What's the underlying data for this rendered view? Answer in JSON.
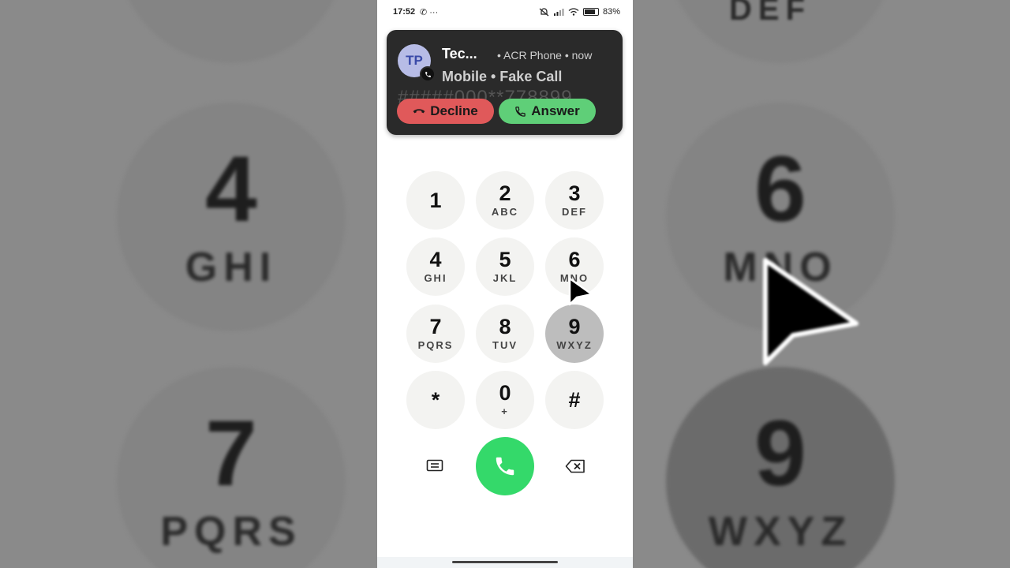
{
  "status_bar": {
    "time": "17:52",
    "left_icons": "✆ ···",
    "battery": "83%"
  },
  "notification": {
    "avatar_initials": "TP",
    "caller_name": "Tec...",
    "meta": "• ACR Phone • now",
    "subtitle": "Mobile • Fake Call",
    "ghost_number": "#####000**778899",
    "decline_label": "Decline",
    "answer_label": "Answer",
    "decline_color": "#e0595a",
    "answer_color": "#5fcf78"
  },
  "dialpad": {
    "keys": [
      {
        "digit": "1",
        "letters": ""
      },
      {
        "digit": "2",
        "letters": "ABC"
      },
      {
        "digit": "3",
        "letters": "DEF"
      },
      {
        "digit": "4",
        "letters": "GHI"
      },
      {
        "digit": "5",
        "letters": "JKL"
      },
      {
        "digit": "6",
        "letters": "MNO"
      },
      {
        "digit": "7",
        "letters": "PQRS"
      },
      {
        "digit": "8",
        "letters": "TUV"
      },
      {
        "digit": "9",
        "letters": "WXYZ"
      },
      {
        "digit": "*",
        "letters": ""
      },
      {
        "digit": "0",
        "letters": "+"
      },
      {
        "digit": "#",
        "letters": ""
      }
    ],
    "pressed_key": "9",
    "call_color": "#34d96a"
  },
  "icons": {
    "message": "message-icon",
    "call": "phone-icon",
    "backspace": "backspace-icon"
  },
  "background_zoom": {
    "top_left_letters": "",
    "top_right_letters": "DEF",
    "left_keys": [
      {
        "digit": "4",
        "letters": "GHI"
      },
      {
        "digit": "7",
        "letters": "PQRS"
      }
    ],
    "right_keys": [
      {
        "digit": "6",
        "letters": "MNO"
      },
      {
        "digit": "9",
        "letters": "WXYZ"
      }
    ]
  }
}
